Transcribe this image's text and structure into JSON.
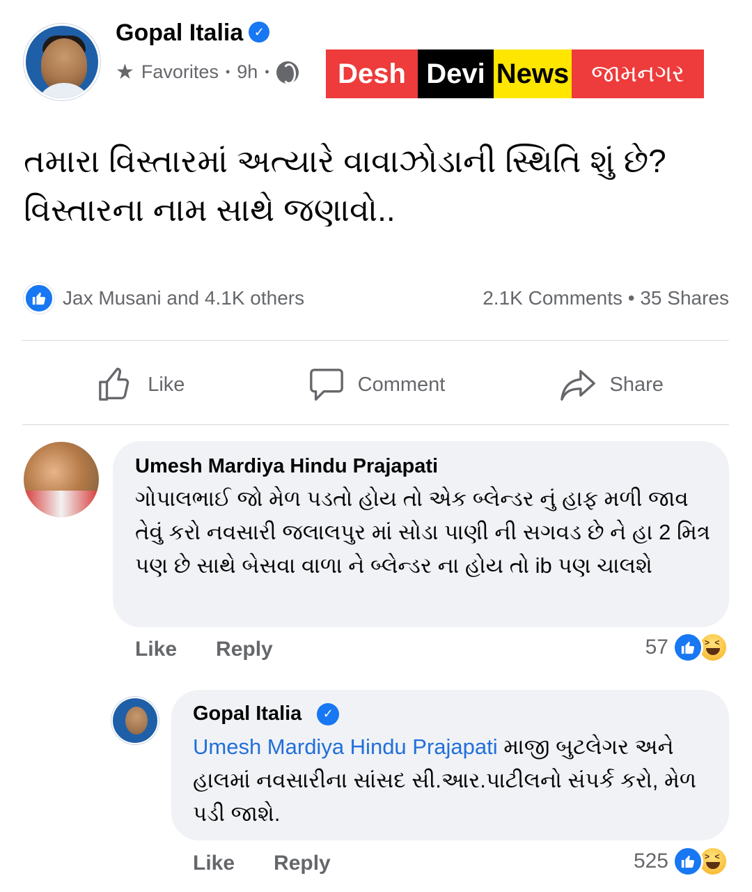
{
  "post": {
    "author": "Gopal Italia",
    "meta_favorites": "Favorites",
    "meta_sep": "•",
    "meta_time": "9h",
    "text_line1": "તમારા વિસ્તારમાં અત્યારે વાવાઝોડાની સ્થિતિ શું છે?",
    "text_line2": "વિસ્તારના નામ સાથે જણાવો..",
    "reactions_summary": "Jax Musani and 4.1K others",
    "comments_count": "2.1K Comments",
    "shares_count": "35 Shares"
  },
  "banner": {
    "word1": "Desh",
    "word2": "Devi",
    "word3": "News",
    "city": "જામનગર",
    "colors": {
      "red": "#ee3b3b",
      "black": "#000000",
      "yellow": "#ffe600"
    }
  },
  "actions": {
    "like": "Like",
    "comment": "Comment",
    "share": "Share"
  },
  "comments": [
    {
      "author": "Umesh Mardiya Hindu Prajapati",
      "text": "ગોપાલભાઈ જો મેળ પડતો હોય તો એક બ્લેન્ડર નું હાફ મળી જાવ તેવું કરો નવસારી જલાલપુર માં સોડા પાણી ની સગવડ છે ને હા 2 મિત્ર પણ છે સાથે બેસવા વાળા ને બ્લેન્ડર ના હોય તો ib પણ ચાલશે",
      "like_label": "Like",
      "reply_label": "Reply",
      "reaction_count": "57"
    },
    {
      "author": "Gopal Italia",
      "mention": "Umesh Mardiya Hindu Prajapati",
      "text": " માજી બુટલેગર અને હાલમાં નવસારીના સાંસદ સી.આર.પાટીલનો સંપર્ક કરો, મેળ પડી જાશે.",
      "like_label": "Like",
      "reply_label": "Reply",
      "reaction_count": "525"
    }
  ],
  "colors": {
    "accent": "#1877f2",
    "secondary_text": "#65676b",
    "bubble": "#f0f2f5",
    "mention": "#216fdb"
  }
}
